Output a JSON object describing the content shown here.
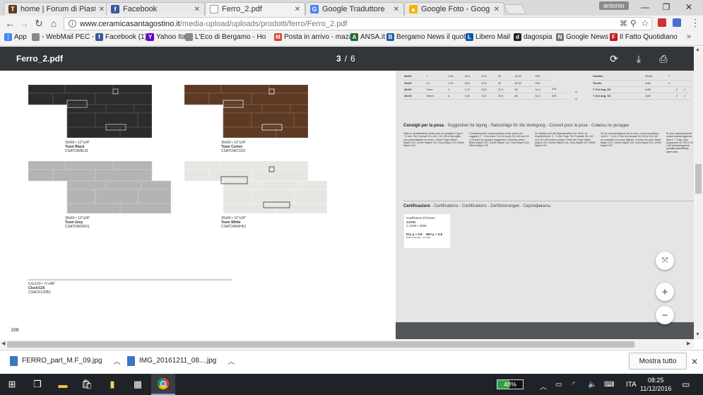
{
  "browser": {
    "tabs": [
      {
        "title": "home | Forum di Piastrel",
        "icon": "forum-favicon-icon",
        "color": "#5a3b1a",
        "letter": "T"
      },
      {
        "title": "Facebook",
        "icon": "facebook-favicon-icon",
        "color": "#3b5998",
        "letter": "f"
      },
      {
        "title": "Ferro_2.pdf",
        "icon": "pdf-document-icon",
        "color": "#ffffff",
        "letter": ""
      },
      {
        "title": "Google Traduttore",
        "icon": "google-translate-icon",
        "color": "#4285f4",
        "letter": "G"
      },
      {
        "title": "Google Foto - Google D",
        "icon": "google-photos-icon",
        "color": "#f4b400",
        "letter": "▲"
      }
    ],
    "user": "antonio",
    "url_host": "www.ceramicasantagostino.it",
    "url_path": "/media-upload/uploads/prodotti/ferro/Ferro_2.pdf",
    "bookmarks": [
      {
        "label": "App",
        "icon": "apps-grid-icon",
        "color": "#4285f4",
        "letter": "⋮"
      },
      {
        "label": "- WebMail PEC -",
        "icon": "document-icon",
        "color": "#888888",
        "letter": ""
      },
      {
        "label": "Facebook (1)",
        "icon": "facebook-favicon-icon",
        "color": "#3b5998",
        "letter": "f"
      },
      {
        "label": "Yahoo Italia",
        "icon": "yahoo-icon",
        "color": "#5f01d1",
        "letter": "Y"
      },
      {
        "label": "L'Eco di Bergamo - Ho",
        "icon": "document-icon",
        "color": "#888888",
        "letter": ""
      },
      {
        "label": "Posta in arrivo - maza",
        "icon": "mail-icon",
        "color": "#d44638",
        "letter": "M"
      },
      {
        "label": "ANSA.it",
        "icon": "ansa-icon",
        "color": "#1e6b2f",
        "letter": "A"
      },
      {
        "label": "Bergamo News il quot",
        "icon": "bergamo-news-icon",
        "color": "#1c5fa8",
        "letter": "B"
      },
      {
        "label": "Libero Mail",
        "icon": "libero-icon",
        "color": "#0a5aa5",
        "letter": "L"
      },
      {
        "label": "dagospia",
        "icon": "dagospia-icon",
        "color": "#222222",
        "letter": "d"
      },
      {
        "label": "Google News",
        "icon": "google-news-icon",
        "color": "#777777",
        "letter": "N"
      },
      {
        "label": "Il Fatto Quotidiano",
        "icon": "fatto-icon",
        "color": "#c4161c",
        "letter": "F"
      }
    ]
  },
  "pdf": {
    "title": "Ferro_2.pdf",
    "page_current": "3",
    "page_sep": "/",
    "page_total": "6",
    "page_number": "168",
    "tiles": [
      {
        "size": "30x60 • 12\"x24\"",
        "name": "Town Black",
        "code": "CSATOWBL01"
      },
      {
        "size": "30x60 • 12\"x24\"",
        "name": "Town Corten",
        "code": "CSATOWCO01"
      },
      {
        "size": "30x60 • 12\"x24\"",
        "name": "Town Grey",
        "code": "CSATOWGR01"
      },
      {
        "size": "30x60 • 12\"x24\"",
        "name": "Town White",
        "code": "CSATOWWH01"
      }
    ],
    "clock": {
      "size": "0,6x120 • ¼\"x48\"",
      "name": "Clock/120",
      "code": "CSACK120B1"
    },
    "table": {
      "rows": [
        [
          "30x60",
          "7",
          "1,26",
          "28,4",
          "22,5",
          "32",
          "40,32",
          "909"
        ],
        [
          "15x60",
          "14",
          "1,26",
          "28,4",
          "22,5",
          "32",
          "40,32",
          "909"
        ],
        [
          "30x60",
          "Town",
          "4",
          "0,72",
          "15,8",
          "21,9",
          "28",
          "14,4",
          "316"
        ],
        [
          "30x30",
          "Street",
          "6",
          "0,54",
          "11,3",
          "20,9",
          "68",
          "32,4",
          "678"
        ]
      ],
      "right_rows": [
        [
          "Gradino",
          "30x60",
          "7",
          "",
          ""
        ],
        [
          "Torello",
          "4x60",
          "4",
          "",
          ""
        ],
        [
          "T. Set Ang. DX",
          "4x60",
          "",
          "2",
          "1"
        ],
        [
          "T. Set Ang. SX",
          "4x60",
          "",
          "2",
          "1"
        ]
      ]
    },
    "laying": {
      "title": "Consigli per la posa",
      "langs": " - Suggestion for laying - Ratschläge für die Verlegung - Conseil pour la pose - Советы по укладке",
      "columns": [
        "Viste le caratteristiche della serie si consiglia: Fuga 2 ÷ 3 mm. Per i formati 30 x 60 e 15 x 60 si consiglia una posa sfalsata al centro. Colore Fuga: Black Mapei 120, Corten Mapei 144, Grey Mapei 110, White Mapei 100",
        "Considering the characteristics of this series we suggest: 2 ÷ 3 mm joint. For the sizes 30 x 60 and 15 x 60 lined up laying is suggested. Grouting colour: Black Mapei 120, Corten Mapei 144, Grey Mapei 110, White Mapei 100",
        "Im Hinblick auf die Eigenschaften der Serie, es empfiehlt sich: 2 ÷ 3 mm Fuge. Für Formate 30 x 60 und 15 x 60 neben verlegt. Farbe der Fuge: Black Mapei 120, Corten Mapei 144, Grey Mapei 110, White Mapei 100",
        "Vu les caractéristiques de la série, nous conseillons: Joint 2 ÷ 3 mm. Pour les formats 30 x 60 et 15 x 60 on conseille une pose alignée. Couleur de joint: Black Mapei 120, Corten Mapei 144, Grey Mapei 110, White Mapei 100",
        "В силу характеристик серии рекомендуется: Шов 2 ÷ 3 мм. Для форматов 30 x 60 и 15 x 60 рекомендуется укладка вразбежку. Цвет шва."
      ]
    },
    "cert": {
      "title": "Certificazioni",
      "langs": " - Certifications - Certifications - Zertifizierungen - Сертификаты",
      "box_title": "Coefficient of friction",
      "standard": "ASTM",
      "norm": "C 1028 • 2006",
      "dry": "Dry µ > 0,6",
      "wet": "Wet µ > 0,6",
      "note": "Natural Surface - Anti Slip"
    }
  },
  "downloads": {
    "items": [
      {
        "name": "FERRO_part_M.F_09.jpg"
      },
      {
        "name": "IMG_20161211_08....jpg"
      }
    ],
    "show_all": "Mostra tutto"
  },
  "taskbar": {
    "battery": "48%",
    "lang": "ITA",
    "time": "08:25",
    "date": "11/12/2016"
  }
}
